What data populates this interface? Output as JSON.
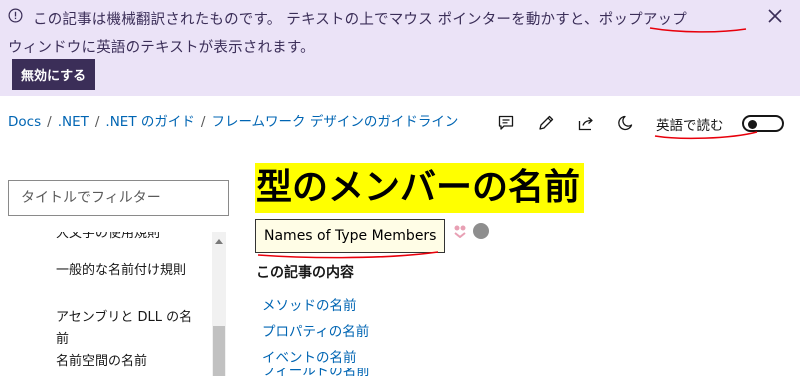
{
  "banner": {
    "message_pre": "この記事は機械翻訳されたものです。 テキストの上でマウス ポインターを動かすと、",
    "message_highlight": "ポップアップ",
    "message_post": "ウィンドウに英語のテキストが表示されます。",
    "disable_button": "無効にする",
    "info_icon": "info-circle-icon",
    "close_icon": "close-icon"
  },
  "breadcrumb": {
    "items": [
      "Docs",
      ".NET",
      ".NET のガイド",
      "フレームワーク デザインのガイドライン"
    ],
    "separator": "/"
  },
  "toolbar": {
    "icons": [
      "feedback-icon",
      "edit-icon",
      "share-icon",
      "theme-moon-icon"
    ],
    "read_in_english": "英語で読む"
  },
  "sidebar": {
    "filter_placeholder": "タイトルでフィルター",
    "items": [
      {
        "label": "大文字の使用規則"
      },
      {
        "label": "一般的な名前付け規則"
      },
      {
        "label": "アセンブリと DLL の名前"
      },
      {
        "label": "名前空間の名前"
      }
    ]
  },
  "main": {
    "title": "型のメンバーの名前",
    "tooltip": "Names of Type Members",
    "section_heading": "この記事の内容",
    "links": [
      {
        "label": "メソッドの名前"
      },
      {
        "label": "プロパティの名前"
      },
      {
        "label": "イベントの名前"
      },
      {
        "label": "フィールドの名前"
      }
    ]
  },
  "colors": {
    "banner_bg": "#ebe3f7",
    "banner_text": "#3b2e58",
    "link": "#0065b3",
    "title_highlight": "#ffff00",
    "annotation": "#e8000b"
  }
}
